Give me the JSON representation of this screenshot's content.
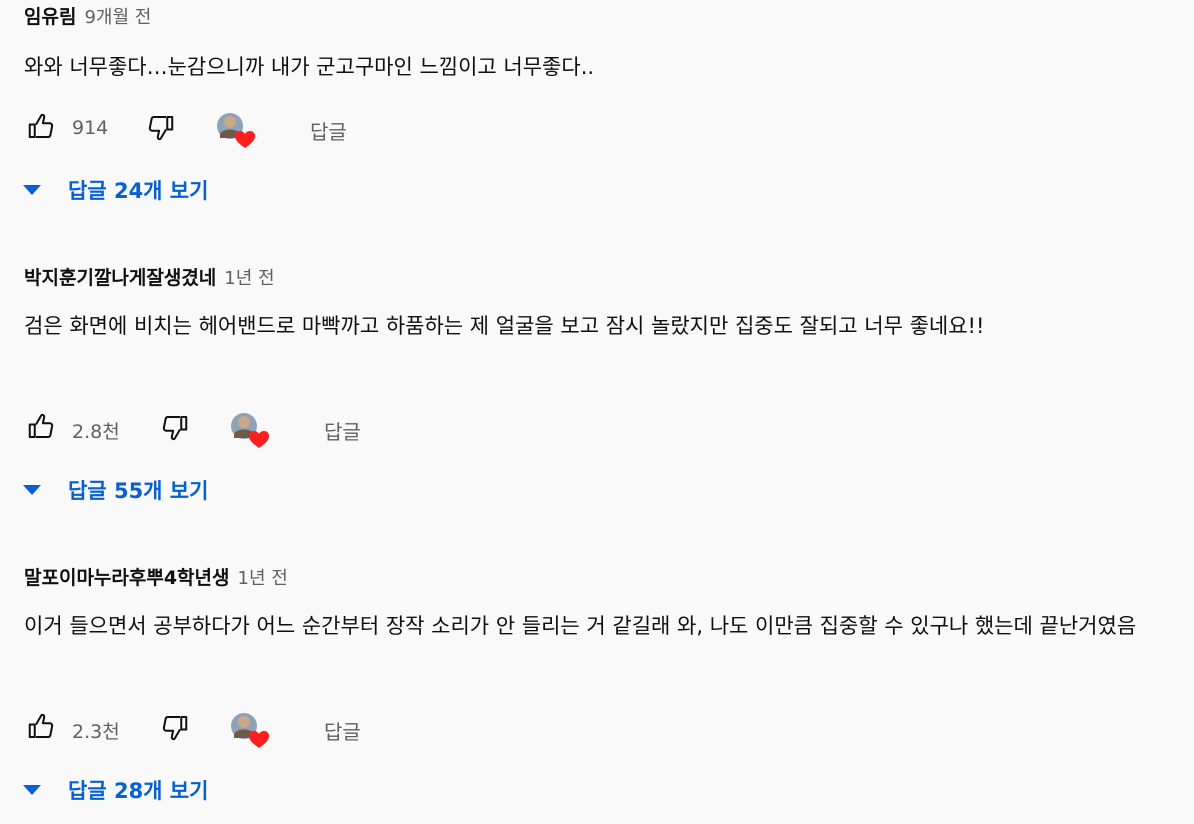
{
  "colors": {
    "background": "#f9f9f9",
    "link_blue": "#065fd4",
    "secondary_text": "#606060",
    "heart_red": "#ff0000"
  },
  "comments": [
    {
      "author": "임유림",
      "time": "9개월 전",
      "text": "와와 너무좋다…눈감으니까 내가 군고구마인 느낌이고 너무좋다..",
      "likes": "914",
      "reply_label": "답글",
      "replies_label": "답글 24개 보기",
      "icons": [
        "like-icon",
        "dislike-icon",
        "creator-heart-icon",
        "caret-down-icon"
      ]
    },
    {
      "author": "박지훈기깔나게잘생겼네",
      "time": "1년 전",
      "text": "검은 화면에 비치는 헤어밴드로 마빡까고 하품하는 제 얼굴을 보고 잠시 놀랐지만 집중도 잘되고 너무 좋네요!!",
      "likes": "2.8천",
      "reply_label": "답글",
      "replies_label": "답글 55개 보기",
      "icons": [
        "like-icon",
        "dislike-icon",
        "creator-heart-icon",
        "caret-down-icon"
      ]
    },
    {
      "author": "말포이마누라후뿌4학년생",
      "time": "1년 전",
      "text": "이거 들으면서 공부하다가 어느 순간부터 장작 소리가 안 들리는 거 같길래 와, 나도 이만큼 집중할 수 있구나 했는데 끝난거였음",
      "likes": "2.3천",
      "reply_label": "답글",
      "replies_label": "답글 28개 보기",
      "icons": [
        "like-icon",
        "dislike-icon",
        "creator-heart-icon",
        "caret-down-icon"
      ]
    }
  ]
}
